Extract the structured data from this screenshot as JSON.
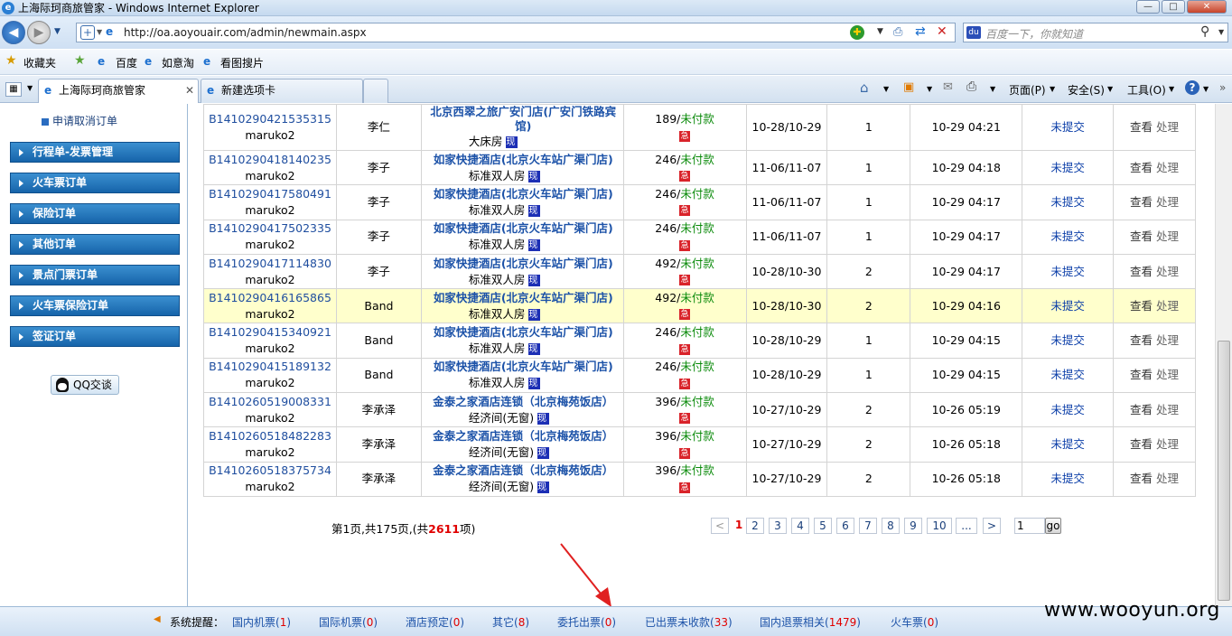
{
  "window": {
    "title": "上海际珂商旅管家 - Windows Internet Explorer"
  },
  "address": {
    "url": "http://oa.aoyouair.com/admin/newmain.aspx",
    "search_placeholder": "百度一下，你就知道"
  },
  "favorites": {
    "label": "收藏夹",
    "items": [
      "百度",
      "如意淘",
      "看图搜片"
    ]
  },
  "tabs": [
    {
      "label": "上海际珂商旅管家"
    },
    {
      "label": "新建选项卡"
    }
  ],
  "commands": {
    "page": "页面(P)",
    "safety": "安全(S)",
    "tools": "工具(O)"
  },
  "sidebar": {
    "top_link": "申请取消订单",
    "menus": [
      "行程单-发票管理",
      "火车票订单",
      "保险订单",
      "其他订单",
      "景点门票订单",
      "火车票保险订单",
      "签证订单"
    ],
    "qq_label": "QQ交谈"
  },
  "orders": [
    {
      "id": "B1410290421535315",
      "user": "maruko2",
      "guest": "李仁",
      "hotel": "北京西翠之旅广安门店(广安门铁路宾馆)",
      "room": "大床房",
      "price": "189",
      "pay": "未付款",
      "dates": "10-28/10-29",
      "qty": "1",
      "time": "10-29 04:21",
      "status": "未提交",
      "view": "查看",
      "handle": "处理"
    },
    {
      "id": "B1410290418140235",
      "user": "maruko2",
      "guest": "李子",
      "hotel": "如家快捷酒店(北京火车站广渠门店)",
      "room": "标准双人房",
      "price": "246",
      "pay": "未付款",
      "dates": "11-06/11-07",
      "qty": "1",
      "time": "10-29 04:18",
      "status": "未提交",
      "view": "查看",
      "handle": "处理"
    },
    {
      "id": "B1410290417580491",
      "user": "maruko2",
      "guest": "李子",
      "hotel": "如家快捷酒店(北京火车站广渠门店)",
      "room": "标准双人房",
      "price": "246",
      "pay": "未付款",
      "dates": "11-06/11-07",
      "qty": "1",
      "time": "10-29 04:17",
      "status": "未提交",
      "view": "查看",
      "handle": "处理"
    },
    {
      "id": "B1410290417502335",
      "user": "maruko2",
      "guest": "李子",
      "hotel": "如家快捷酒店(北京火车站广渠门店)",
      "room": "标准双人房",
      "price": "246",
      "pay": "未付款",
      "dates": "11-06/11-07",
      "qty": "1",
      "time": "10-29 04:17",
      "status": "未提交",
      "view": "查看",
      "handle": "处理"
    },
    {
      "id": "B1410290417114830",
      "user": "maruko2",
      "guest": "李子",
      "hotel": "如家快捷酒店(北京火车站广渠门店)",
      "room": "标准双人房",
      "price": "492",
      "pay": "未付款",
      "dates": "10-28/10-30",
      "qty": "2",
      "time": "10-29 04:17",
      "status": "未提交",
      "view": "查看",
      "handle": "处理"
    },
    {
      "id": "B1410290416165865",
      "user": "maruko2",
      "guest": "Band",
      "hotel": "如家快捷酒店(北京火车站广渠门店)",
      "room": "标准双人房",
      "price": "492",
      "pay": "未付款",
      "dates": "10-28/10-30",
      "qty": "2",
      "time": "10-29 04:16",
      "status": "未提交",
      "view": "查看",
      "handle": "处理"
    },
    {
      "id": "B1410290415340921",
      "user": "maruko2",
      "guest": "Band",
      "hotel": "如家快捷酒店(北京火车站广渠门店)",
      "room": "标准双人房",
      "price": "246",
      "pay": "未付款",
      "dates": "10-28/10-29",
      "qty": "1",
      "time": "10-29 04:15",
      "status": "未提交",
      "view": "查看",
      "handle": "处理"
    },
    {
      "id": "B1410290415189132",
      "user": "maruko2",
      "guest": "Band",
      "hotel": "如家快捷酒店(北京火车站广渠门店)",
      "room": "标准双人房",
      "price": "246",
      "pay": "未付款",
      "dates": "10-28/10-29",
      "qty": "1",
      "time": "10-29 04:15",
      "status": "未提交",
      "view": "查看",
      "handle": "处理"
    },
    {
      "id": "B1410260519008331",
      "user": "maruko2",
      "guest": "李承泽",
      "hotel": "金泰之家酒店连锁（北京梅苑饭店）",
      "room": "经济间(无窗)",
      "price": "396",
      "pay": "未付款",
      "dates": "10-27/10-29",
      "qty": "2",
      "time": "10-26 05:19",
      "status": "未提交",
      "view": "查看",
      "handle": "处理"
    },
    {
      "id": "B1410260518482283",
      "user": "maruko2",
      "guest": "李承泽",
      "hotel": "金泰之家酒店连锁（北京梅苑饭店）",
      "room": "经济间(无窗)",
      "price": "396",
      "pay": "未付款",
      "dates": "10-27/10-29",
      "qty": "2",
      "time": "10-26 05:18",
      "status": "未提交",
      "view": "查看",
      "handle": "处理"
    },
    {
      "id": "B1410260518375734",
      "user": "maruko2",
      "guest": "李承泽",
      "hotel": "金泰之家酒店连锁（北京梅苑饭店）",
      "room": "经济间(无窗)",
      "price": "396",
      "pay": "未付款",
      "dates": "10-27/10-29",
      "qty": "2",
      "time": "10-26 05:18",
      "status": "未提交",
      "view": "查看",
      "handle": "处理"
    }
  ],
  "badges": {
    "red": "急",
    "blue": "现"
  },
  "pager": {
    "prefix": "第1页,共175页,(共",
    "total": "2611",
    "suffix": "项)",
    "prev": "<",
    "next": ">",
    "pages": [
      "1",
      "2",
      "3",
      "4",
      "5",
      "6",
      "7",
      "8",
      "9",
      "10",
      "..."
    ],
    "goto_value": "1",
    "go": "go"
  },
  "status": {
    "label": "系统提醒：",
    "items": [
      {
        "label": "国内机票(",
        "count": "1",
        "close": ")"
      },
      {
        "label": "国际机票(",
        "count": "0",
        "close": ")"
      },
      {
        "label": "酒店预定(",
        "count": "0",
        "close": ")"
      },
      {
        "label": "其它(",
        "count": "8",
        "close": ")"
      },
      {
        "label": "委托出票(",
        "count": "0",
        "close": ")"
      },
      {
        "label": "已出票未收款(",
        "count": "33",
        "close": ")"
      },
      {
        "label": "国内退票相关(",
        "count": "1479",
        "close": ")"
      },
      {
        "label": "火车票(",
        "count": "0",
        "close": ")"
      }
    ]
  },
  "watermark": "www.wooyun.org"
}
